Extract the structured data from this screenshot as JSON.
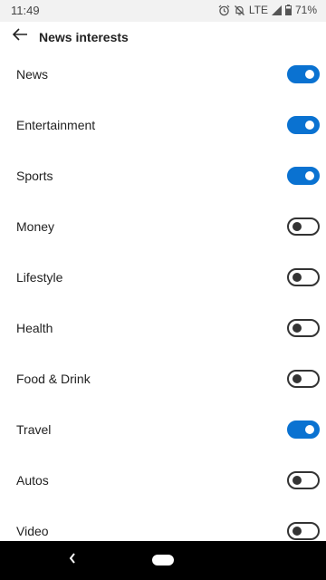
{
  "status_bar": {
    "time": "11:49",
    "network": "LTE",
    "battery": "71%",
    "icons": [
      "alarm-icon",
      "bell-off-icon",
      "signal-icon",
      "battery-icon"
    ]
  },
  "header": {
    "title": "News interests",
    "back_icon": "arrow-left-icon"
  },
  "interests": [
    {
      "label": "News",
      "enabled": true
    },
    {
      "label": "Entertainment",
      "enabled": true
    },
    {
      "label": "Sports",
      "enabled": true
    },
    {
      "label": "Money",
      "enabled": false
    },
    {
      "label": "Lifestyle",
      "enabled": false
    },
    {
      "label": "Health",
      "enabled": false
    },
    {
      "label": "Food & Drink",
      "enabled": false
    },
    {
      "label": "Travel",
      "enabled": true
    },
    {
      "label": "Autos",
      "enabled": false
    },
    {
      "label": "Video",
      "enabled": false
    }
  ],
  "colors": {
    "accent": "#0a72d1",
    "toggle_off": "#333333",
    "status_bar_bg": "#f2f2f2",
    "nav_bar_bg": "#000000"
  },
  "nav_bar": {
    "back_icon": "chevron-left-icon",
    "home_icon": "home-pill-icon"
  }
}
